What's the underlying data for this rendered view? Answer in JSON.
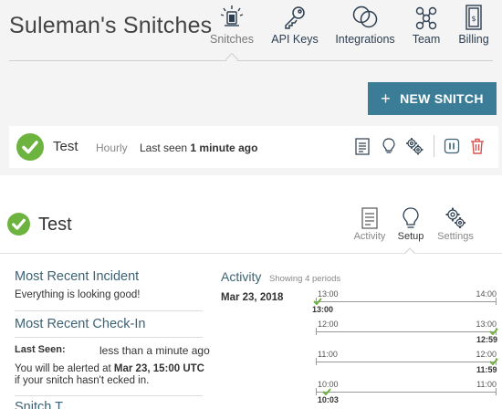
{
  "header": {
    "org_title": "Suleman's Snitches",
    "nav": [
      {
        "label": "Snitches",
        "icon": "alarm-light-icon",
        "active": true
      },
      {
        "label": "API Keys",
        "icon": "key-icon",
        "active": false
      },
      {
        "label": "Integrations",
        "icon": "integrations-circles-icon",
        "active": false
      },
      {
        "label": "Team",
        "icon": "team-network-icon",
        "active": false
      },
      {
        "label": "Billing",
        "icon": "billing-receipt-icon",
        "active": false
      }
    ]
  },
  "toolbar": {
    "new_snitch_label": "NEW SNITCH",
    "new_snitch_color": "#3b7d97"
  },
  "snitch_row": {
    "name": "Test",
    "interval": "Hourly",
    "last_seen_prefix": "Last seen",
    "last_seen_value": "1 minute ago",
    "status_color": "#6cb33f",
    "pause_color": "#3b6275",
    "delete_color": "#d9534f"
  },
  "detail": {
    "name": "Test",
    "tabs": [
      {
        "label": "Activity",
        "icon": "clipboard-icon",
        "active": false
      },
      {
        "label": "Setup",
        "icon": "lightbulb-icon",
        "active": true
      },
      {
        "label": "Settings",
        "icon": "gears-icon",
        "active": false
      }
    ],
    "incident_title": "Most Recent Incident",
    "incident_text": "Everything is looking good!",
    "checkin_title": "Most Recent Check-In",
    "last_seen_label": "Last Seen:",
    "last_seen_value": "less than a minute ago",
    "alert_prefix": "You will be alerted at",
    "alert_time": "Mar 23, 15:00 UTC",
    "alert_suffix_a": "if your snitch hasn't",
    "alert_suffix_b": "ecked in.",
    "next_title_partial": "Snitch T",
    "activity_title": "Activity",
    "activity_sub": "Showing 4 periods",
    "activity_date": "Mar 23, 2018",
    "periods": [
      {
        "start": "13:00",
        "end": "14:00",
        "checkin": "13:00",
        "pos": 0.0
      },
      {
        "start": "12:00",
        "end": "13:00",
        "checkin": "12:59",
        "pos": 0.985
      },
      {
        "start": "11:00",
        "end": "12:00",
        "checkin": "11:59",
        "pos": 0.985
      },
      {
        "start": "10:00",
        "end": "11:00",
        "checkin": "10:03",
        "pos": 0.05
      }
    ]
  }
}
